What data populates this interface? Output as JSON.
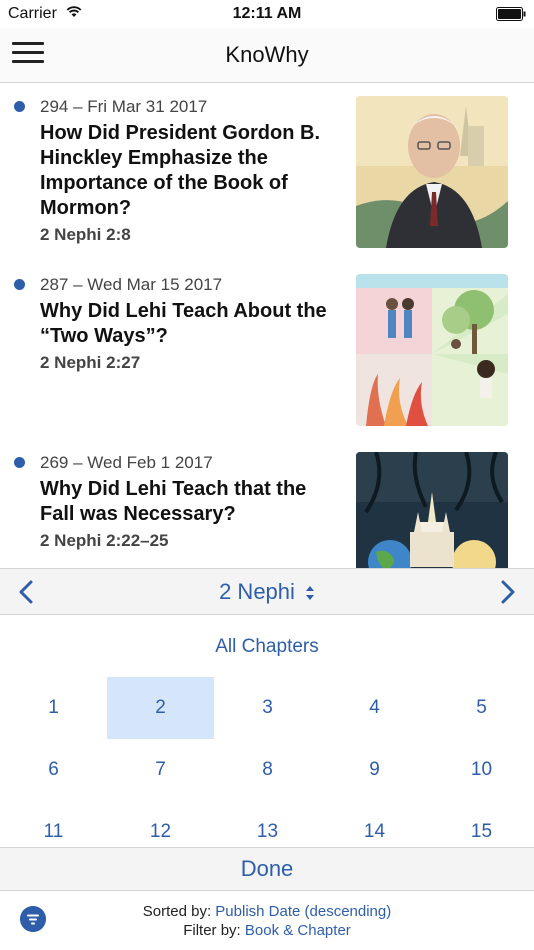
{
  "status": {
    "carrier": "Carrier",
    "time": "12:11 AM"
  },
  "nav": {
    "title": "KnoWhy"
  },
  "items": [
    {
      "meta": "294 – Fri Mar 31 2017",
      "title": "How Did President Gordon B. Hinckley Emphasize the Importance of the Book of Mormon?",
      "ref": "2 Nephi 2:8"
    },
    {
      "meta": "287 – Wed Mar 15 2017",
      "title": "Why Did Lehi Teach About the “Two Ways”?",
      "ref": "2 Nephi 2:27"
    },
    {
      "meta": "269 – Wed Feb 1 2017",
      "title": "Why Did Lehi Teach that the Fall was Necessary?",
      "ref": "2 Nephi 2:22–25"
    }
  ],
  "picker": {
    "book": "2 Nephi",
    "all_label": "All Chapters",
    "selected": "2",
    "chapters": [
      "1",
      "2",
      "3",
      "4",
      "5",
      "6",
      "7",
      "8",
      "9",
      "10",
      "11",
      "12",
      "13",
      "14",
      "15"
    ]
  },
  "done_label": "Done",
  "footer": {
    "sorted_label": "Sorted by: ",
    "sorted_value": "Publish Date (descending)",
    "filter_label": "Filter by: ",
    "filter_value": "Book & Chapter"
  },
  "colors": {
    "accent": "#2e5eaa",
    "selected_bg": "#d6e6fa"
  }
}
